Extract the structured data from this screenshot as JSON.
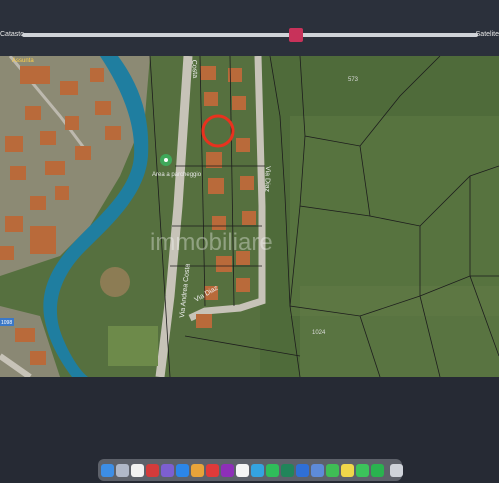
{
  "slider": {
    "left_label": "Catasto",
    "right_label": "Satelite",
    "value_percent": 60
  },
  "map": {
    "labels": {
      "street_vertical": "Via Andrea Costa",
      "street_upper": "Costa",
      "street_right": "Via Diaz",
      "street_lower": "Via Diaz",
      "area": "Area a parcheggio",
      "poi": "Assunta",
      "watermark": "immobiliare",
      "parcel_1": "573",
      "parcel_2": "1024",
      "road_sign": "1098"
    },
    "marker_color": "#e8321e"
  },
  "dock": {
    "icons": [
      {
        "name": "finder-icon",
        "color": "#3d8ee6"
      },
      {
        "name": "launchpad-icon",
        "color": "#b0b8c8"
      },
      {
        "name": "calendar-icon",
        "color": "#f2f2f2"
      },
      {
        "name": "mail-icon",
        "color": "#d33b3b"
      },
      {
        "name": "notes-icon",
        "color": "#7d5fd0"
      },
      {
        "name": "appstore-icon",
        "color": "#2c86e8"
      },
      {
        "name": "xcode-icon",
        "color": "#e7a33a"
      },
      {
        "name": "indesign-icon",
        "color": "#e03a3a"
      },
      {
        "name": "photoshop-icon",
        "color": "#8e2fb8"
      },
      {
        "name": "notion-icon",
        "color": "#f5f5f5"
      },
      {
        "name": "telegram-icon",
        "color": "#34a3e0"
      },
      {
        "name": "spotify-icon",
        "color": "#2fbd5a"
      },
      {
        "name": "excel-icon",
        "color": "#21855a"
      },
      {
        "name": "word-icon",
        "color": "#2f6fd6"
      },
      {
        "name": "preview-icon",
        "color": "#5e8bd8"
      },
      {
        "name": "facetime-icon",
        "color": "#3fbd55"
      },
      {
        "name": "stickies-icon",
        "color": "#f0d64a"
      },
      {
        "name": "messages-icon",
        "color": "#3cc35b"
      },
      {
        "name": "whatsapp-icon",
        "color": "#2ab24f"
      },
      {
        "name": "trash-icon",
        "color": "#cfd3da"
      }
    ]
  }
}
